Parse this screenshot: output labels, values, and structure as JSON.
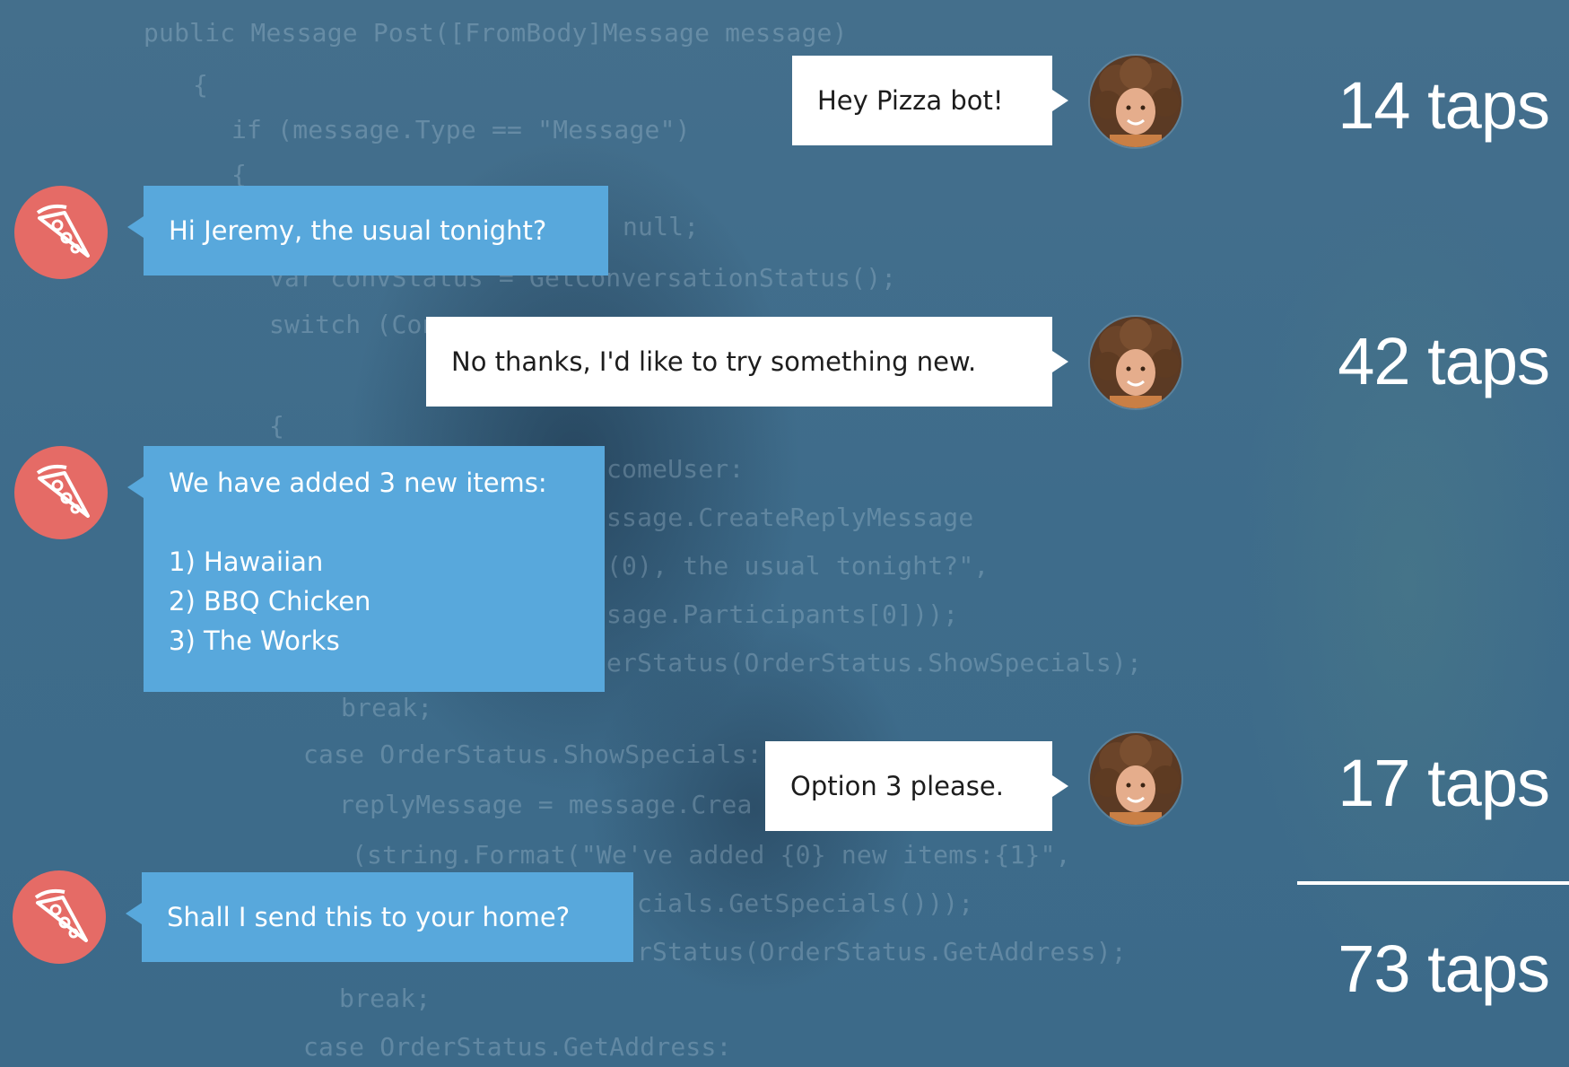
{
  "background_code": [
    "public Message Post([FromBody]Message message)",
    "{",
    "if (message.Type == \"Message\")",
    "{",
    "null;",
    "var convStatus = GetConversationStatus();",
    "switch (Con",
    "{",
    "comeUser:",
    "ssage.CreateReplyMessage",
    "(0), the usual tonight?\",",
    "sage.Participants[0]));",
    "erStatus(OrderStatus.ShowSpecials);",
    "break;",
    "case OrderStatus.ShowSpecials:",
    "replyMessage = message.Crea",
    "(string.Format(\"We've added {0} new items:{1}\",",
    "cials.GetSpecials()));",
    "rStatus(OrderStatus.GetAddress);",
    "break;",
    "case OrderStatus.GetAddress:"
  ],
  "conversation": {
    "user_1": "Hey Pizza bot!",
    "bot_1": "Hi Jeremy, the usual tonight?",
    "user_2": "No thanks, I'd like to try something new.",
    "bot_2_lines": [
      "We have added 3 new items:",
      "",
      "1) Hawaiian",
      "2) BBQ Chicken",
      "3) The Works"
    ],
    "user_3": "Option 3 please.",
    "bot_3": "Shall I send this to your home?"
  },
  "bot_avatar_icon": "pizza-slice-icon",
  "user_avatar_icon": "person-photo-icon",
  "tap_counts": {
    "row_1": "14 taps",
    "row_2": "42 taps",
    "row_3": "17 taps",
    "total": "73 taps"
  },
  "colors": {
    "background": "#3f6f8f",
    "bot_bubble": "#58a8dc",
    "user_bubble": "#ffffff",
    "bot_avatar": "#e56b66",
    "tap_text": "#ffffff"
  }
}
